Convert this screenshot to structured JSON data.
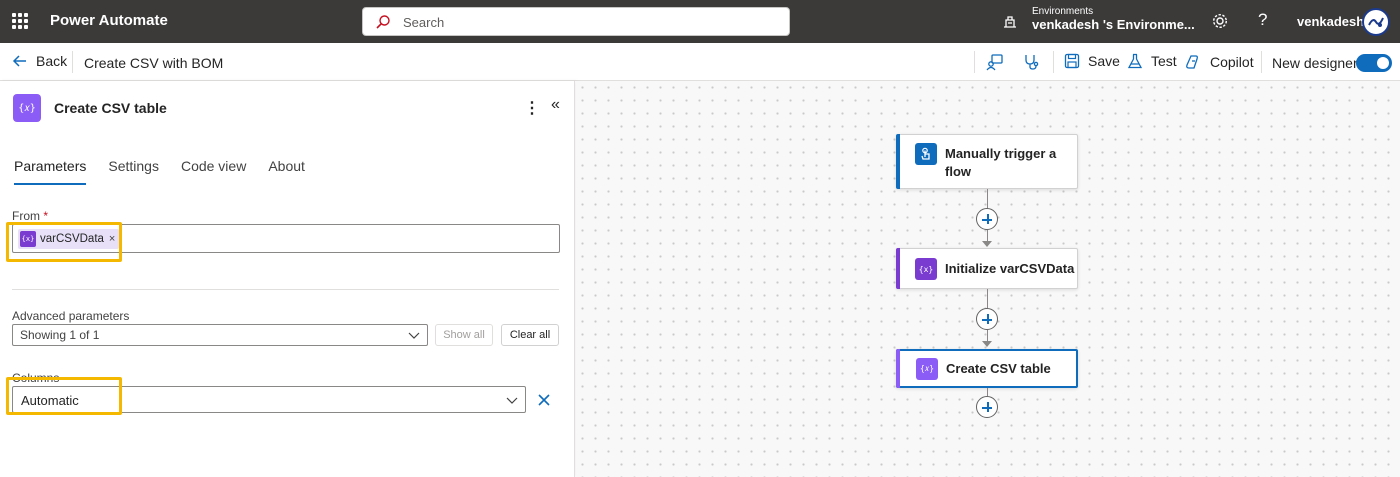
{
  "header": {
    "app_name": "Power Automate",
    "search_placeholder": "Search",
    "environment_label": "Environments",
    "environment_name": "venkadesh 's Environme...",
    "help_glyph": "?",
    "user_name": "venkadesh"
  },
  "command_bar": {
    "back_label": "Back",
    "flow_name": "Create CSV with BOM",
    "save_label": "Save",
    "test_label": "Test",
    "copilot_label": "Copilot",
    "new_designer_label": "New designer",
    "new_designer_enabled": true
  },
  "panel": {
    "icon_text": "{𝑥}",
    "title": "Create CSV table",
    "tabs": [
      "Parameters",
      "Settings",
      "Code view",
      "About"
    ],
    "active_tab": "Parameters",
    "from_label": "From",
    "required_mark": "*",
    "from_token": {
      "icon_text": "{x}",
      "label": "varCSVData",
      "remove": "×"
    },
    "advanced_label": "Advanced parameters",
    "advanced_value": "Showing 1 of 1",
    "show_all_label": "Show all",
    "clear_all_label": "Clear all",
    "columns_label": "Columns",
    "columns_value": "Automatic"
  },
  "canvas": {
    "nodes": [
      {
        "label": "Manually trigger a flow",
        "icon": "hand-touch-icon",
        "color": "#0f6cbd"
      },
      {
        "label": "Initialize varCSVData",
        "icon_text": "{x}",
        "color": "#7a3bd1"
      },
      {
        "label": "Create CSV table",
        "icon_text": "{𝑥}",
        "color": "#8b5cf6",
        "selected": true
      }
    ]
  },
  "colors": {
    "topbar": "#3b3a39",
    "accent": "#0f6cbd",
    "highlight": "#f5b800",
    "variable_purple": "#7a3bd1"
  }
}
